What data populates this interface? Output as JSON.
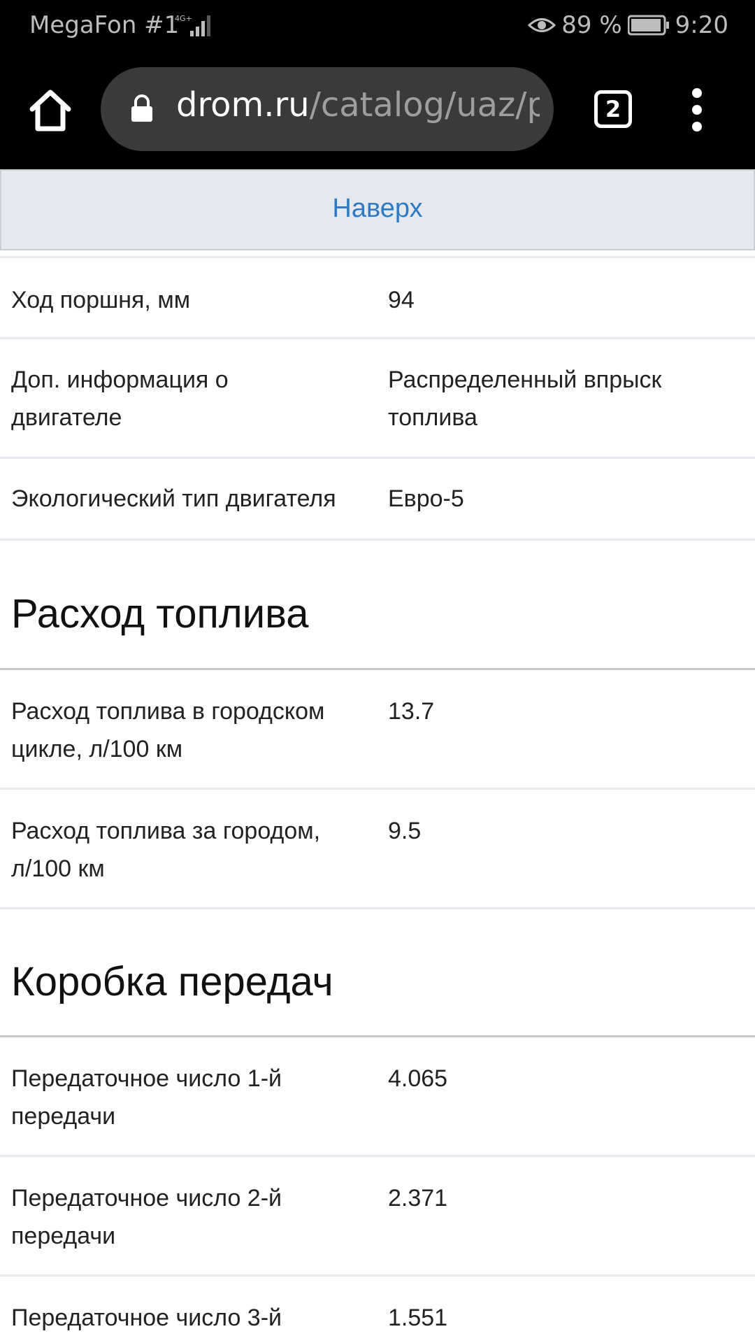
{
  "status_bar": {
    "carrier": "MegaFon #1",
    "network": "4G",
    "battery": "89 %",
    "time": "9:20"
  },
  "browser": {
    "url_host": "drom.ru",
    "url_path": "/catalog/uaz/pa",
    "tab_count": "2"
  },
  "top_link": "Наверх",
  "engine_rows": [
    {
      "label": "Ход поршня, мм",
      "value": "94"
    },
    {
      "label": "Доп. информация о двигателе",
      "value": "Распределенный впрыск топлива"
    },
    {
      "label": "Экологический тип двигателя",
      "value": "Евро-5"
    }
  ],
  "fuel_section": {
    "title": "Расход топлива",
    "rows": [
      {
        "label": "Расход топлива в городском цикле, л/100 км",
        "value": "13.7"
      },
      {
        "label": "Расход топлива за городом, л/100 км",
        "value": "9.5"
      }
    ]
  },
  "gearbox_section": {
    "title": "Коробка передач",
    "rows": [
      {
        "label": "Передаточное число 1-й передачи",
        "value": "4.065"
      },
      {
        "label": "Передаточное число 2-й передачи",
        "value": "2.371"
      },
      {
        "label": "Передаточное число 3-й",
        "value": "1.551"
      }
    ]
  }
}
